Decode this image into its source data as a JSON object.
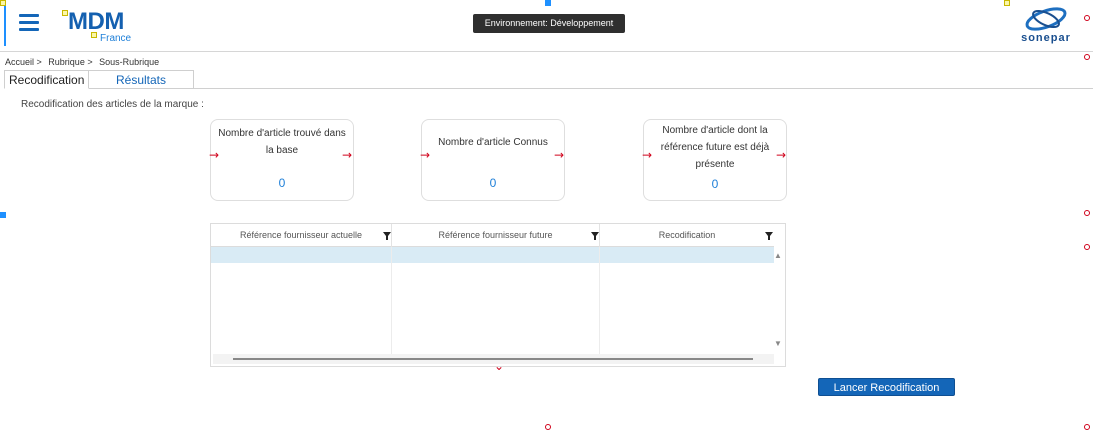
{
  "header": {
    "logo_main": "MDM",
    "logo_sub": "France",
    "environment": "Environnement: Développement",
    "brand": "sonepar"
  },
  "breadcrumb": [
    "Accueil >",
    "Rubrique >",
    "Sous-Rubrique"
  ],
  "tabs": [
    {
      "label": "Recodification",
      "active": true
    },
    {
      "label": "Résultats",
      "active": false
    }
  ],
  "section_label": "Recodification des articles de la marque :",
  "cards": [
    {
      "title": "Nombre d'article trouvé dans la base",
      "value": "0"
    },
    {
      "title": "Nombre d'article Connus",
      "value": "0"
    },
    {
      "title": "Nombre d'article dont la référence future est déjà présente",
      "value": "0"
    }
  ],
  "grid": {
    "columns": [
      "Référence fournisseur actuelle",
      "Référence fournisseur future",
      "Recodification"
    ]
  },
  "actions": {
    "launch": "Lancer Recodification"
  },
  "colors": {
    "primary": "#1466b8",
    "accent": "#1e7fd8",
    "row_selected": "#d9ebf5"
  }
}
